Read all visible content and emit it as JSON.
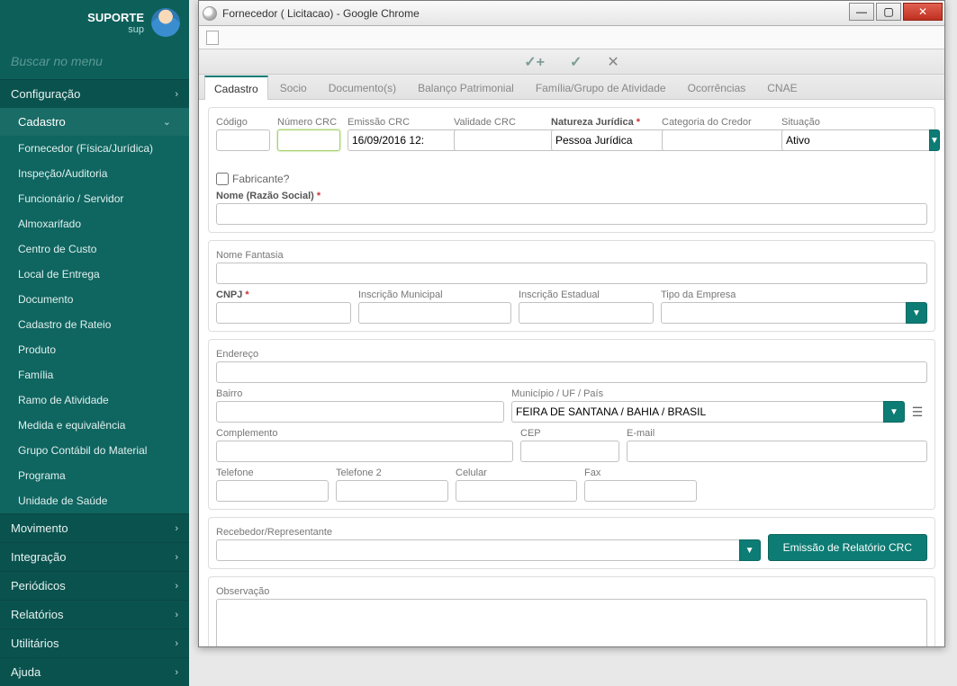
{
  "sidebar": {
    "user_name": "SUPORTE",
    "user_sub": "sup",
    "search_placeholder": "Buscar no menu",
    "groups": {
      "config": "Configuração",
      "cadastro": "Cadastro",
      "movimento": "Movimento",
      "integracao": "Integração",
      "periodicos": "Periódicos",
      "relatorios": "Relatórios",
      "utilitarios": "Utilitários",
      "ajuda": "Ajuda"
    },
    "cadastro_items": [
      "Fornecedor (Física/Jurídica)",
      "Inspeção/Auditoria",
      "Funcionário / Servidor",
      "Almoxarifado",
      "Centro de Custo",
      "Local de Entrega",
      "Documento",
      "Cadastro de Rateio",
      "Produto",
      "Família",
      "Ramo de Atividade",
      "Medida e equivalência",
      "Grupo Contábil do Material",
      "Programa",
      "Unidade de Saúde"
    ]
  },
  "window": {
    "title": "Fornecedor ( Licitacao) - Google Chrome"
  },
  "tabs": [
    "Cadastro",
    "Socio",
    "Documento(s)",
    "Balanço Patrimonial",
    "Família/Grupo de Atividade",
    "Ocorrências",
    "CNAE"
  ],
  "labels": {
    "codigo": "Código",
    "numero_crc": "Número CRC",
    "emissao_crc": "Emissão CRC",
    "validade_crc": "Validade CRC",
    "natureza": "Natureza Jurídica",
    "categoria": "Categoria do Credor",
    "situacao": "Situação",
    "fabricante": "Fabricante?",
    "razao": "Nome (Razão Social)",
    "fantasia": "Nome Fantasia",
    "cnpj": "CNPJ",
    "insc_mun": "Inscrição Municipal",
    "insc_est": "Inscrição Estadual",
    "tipo_emp": "Tipo da Empresa",
    "endereco": "Endereço",
    "bairro": "Bairro",
    "municipio": "Município / UF / País",
    "complemento": "Complemento",
    "cep": "CEP",
    "email": "E-mail",
    "telefone": "Telefone",
    "telefone2": "Telefone 2",
    "celular": "Celular",
    "fax": "Fax",
    "recebedor": "Recebedor/Representante",
    "observacao": "Observação"
  },
  "values": {
    "emissao_crc": "16/09/2016 12:",
    "natureza": "Pessoa Jurídica",
    "situacao": "Ativo",
    "municipio": "FEIRA DE SANTANA / BAHIA / BRASIL"
  },
  "buttons": {
    "emissao_crc": "Emissão de Relatório CRC"
  }
}
